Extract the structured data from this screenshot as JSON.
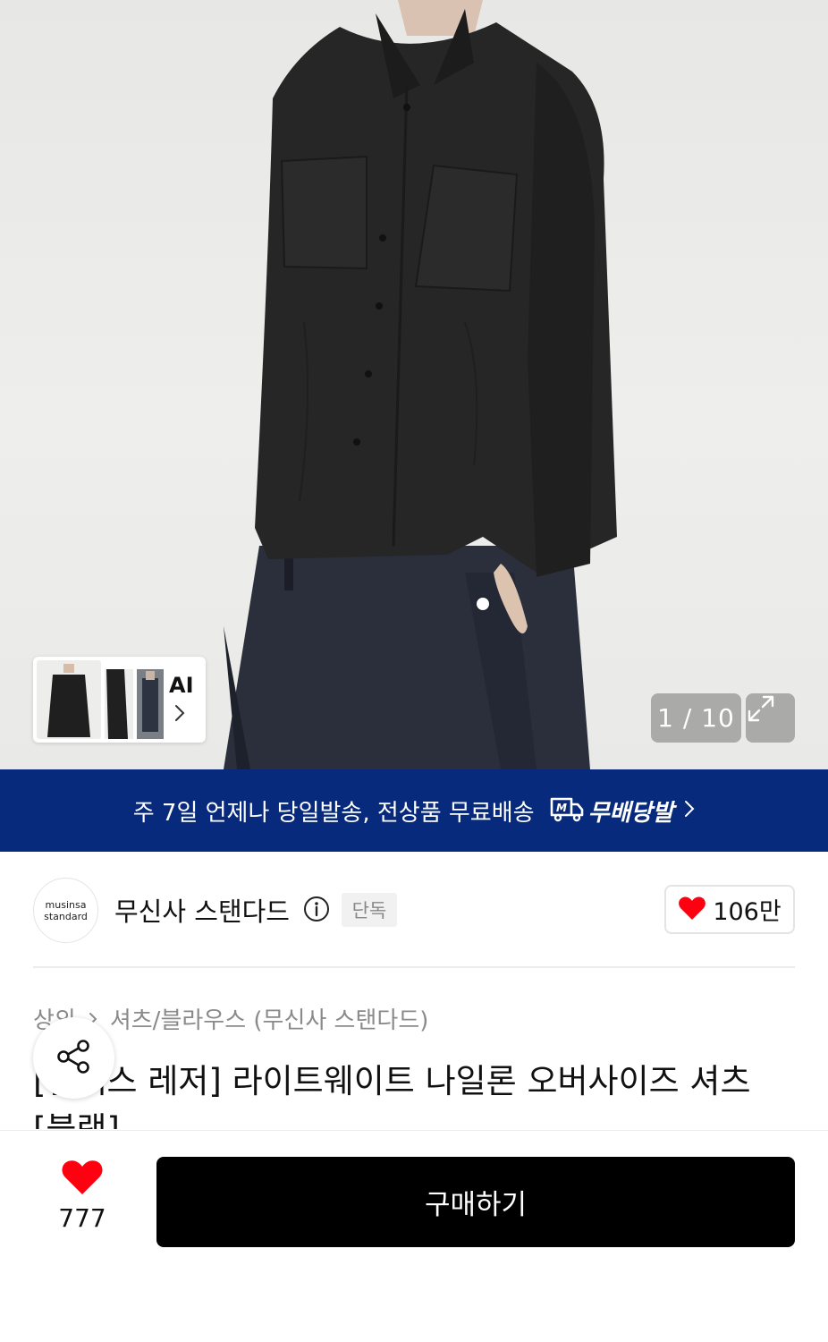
{
  "gallery": {
    "counter": "1 / 10",
    "ai_label": "AI"
  },
  "banner": {
    "text": "주 7일 언제나 당일발송, 전상품 무료배송",
    "brand_label": "무배당발"
  },
  "brand": {
    "logo_line1": "musinsa",
    "logo_line2": "standard",
    "name": "무신사 스탠다드",
    "badge": "단독",
    "like_count": "106만"
  },
  "breadcrumb": {
    "category": "상의",
    "subcategory": "셔츠/블라우스 (무신사 스탠다드)"
  },
  "product": {
    "title": "[릴렉스 레저] 라이트웨이트 나일론 오버사이즈 셔츠 [블랙]"
  },
  "bottom": {
    "like_count": "777",
    "buy_label": "구매하기"
  },
  "colors": {
    "banner_bg": "#082a7c",
    "heart": "#ff0011",
    "buy_bg": "#000000"
  },
  "icons": [
    "chevron-right-icon",
    "expand-icon",
    "delivery-truck-icon",
    "info-icon",
    "heart-icon",
    "share-icon"
  ]
}
